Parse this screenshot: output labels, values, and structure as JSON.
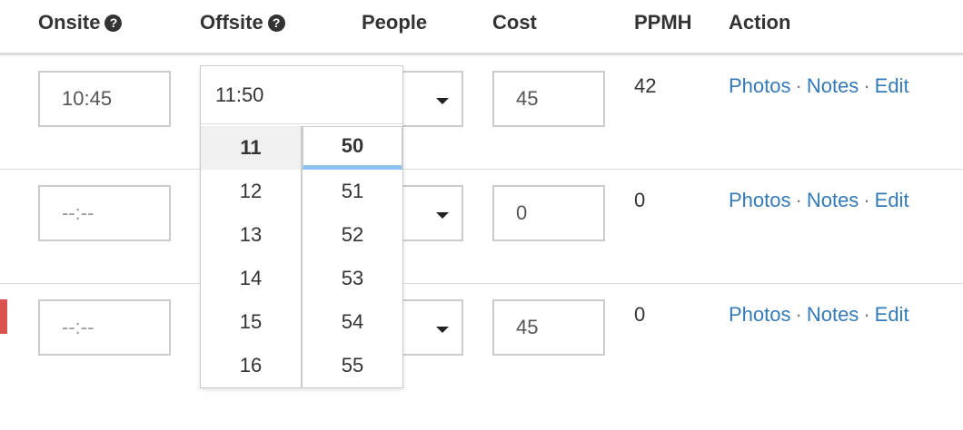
{
  "headers": {
    "onsite": "Onsite",
    "offsite": "Offsite",
    "people": "People",
    "cost": "Cost",
    "ppmh": "PPMH",
    "action": "Action"
  },
  "rows": [
    {
      "onsite": "10:45",
      "cost": "45",
      "ppmh": "42"
    },
    {
      "onsite": "--:--",
      "cost": "0",
      "ppmh": "0"
    },
    {
      "onsite": "--:--",
      "cost": "45",
      "ppmh": "0"
    }
  ],
  "action_links": {
    "photos": "Photos",
    "notes": "Notes",
    "edit": "Edit",
    "separator": "·"
  },
  "time_picker": {
    "value": "11:50",
    "hours": [
      "11",
      "12",
      "13",
      "14",
      "15",
      "16"
    ],
    "minutes": [
      "50",
      "51",
      "52",
      "53",
      "54",
      "55"
    ],
    "selected_hour": "11",
    "selected_minute": "50"
  },
  "icons": {
    "help": "question-circle-icon",
    "dropdown": "caret-down-icon"
  },
  "colors": {
    "link": "#337ab7",
    "row_flag": "#d9534f",
    "minute_highlight": "#90c2f1"
  }
}
